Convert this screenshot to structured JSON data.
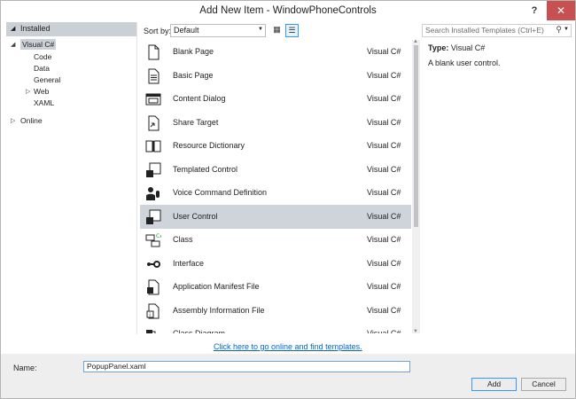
{
  "window": {
    "title": "Add New Item - WindowPhoneControls",
    "help": "?",
    "close": "✕"
  },
  "tree": {
    "installed": "Installed",
    "visual_csharp": "Visual C#",
    "code": "Code",
    "data": "Data",
    "general": "General",
    "web": "Web",
    "xaml": "XAML",
    "online": "Online"
  },
  "toolbar": {
    "sort_label": "Sort by:",
    "sort_value": "Default"
  },
  "search": {
    "placeholder": "Search Installed Templates (Ctrl+E)"
  },
  "templates": [
    {
      "name": "Blank Page",
      "lang": "Visual C#",
      "icon": "blank-page-icon"
    },
    {
      "name": "Basic Page",
      "lang": "Visual C#",
      "icon": "basic-page-icon"
    },
    {
      "name": "Content Dialog",
      "lang": "Visual C#",
      "icon": "content-dialog-icon"
    },
    {
      "name": "Share Target",
      "lang": "Visual C#",
      "icon": "share-target-icon"
    },
    {
      "name": "Resource Dictionary",
      "lang": "Visual C#",
      "icon": "resource-dictionary-icon"
    },
    {
      "name": "Templated Control",
      "lang": "Visual C#",
      "icon": "templated-control-icon"
    },
    {
      "name": "Voice Command Definition",
      "lang": "Visual C#",
      "icon": "voice-command-icon"
    },
    {
      "name": "User Control",
      "lang": "Visual C#",
      "icon": "user-control-icon"
    },
    {
      "name": "Class",
      "lang": "Visual C#",
      "icon": "class-icon"
    },
    {
      "name": "Interface",
      "lang": "Visual C#",
      "icon": "interface-icon"
    },
    {
      "name": "Application Manifest File",
      "lang": "Visual C#",
      "icon": "manifest-icon"
    },
    {
      "name": "Assembly Information File",
      "lang": "Visual C#",
      "icon": "assembly-info-icon"
    },
    {
      "name": "Class Diagram",
      "lang": "Visual C#",
      "icon": "class-diagram-icon"
    }
  ],
  "details": {
    "type_label": "Type:",
    "type_value": "Visual C#",
    "description": "A blank user control."
  },
  "online_link": "Click here to go online and find templates.",
  "name_field": {
    "label": "Name:",
    "value": "PopupPanel.xaml"
  },
  "buttons": {
    "add": "Add",
    "cancel": "Cancel"
  }
}
